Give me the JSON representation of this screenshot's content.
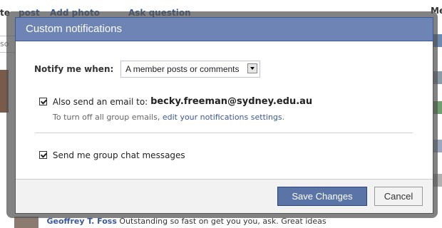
{
  "background": {
    "top_fragment_left": "te",
    "top_fragment_post": "post",
    "add_photo": "Add photo",
    "ask_question": "Ask question",
    "right_fragment": "Me",
    "left_input_fragment": "so",
    "bottom_name": "Geoffrey T. Foss",
    "bottom_text": " Outstanding so fast on get you you, ask. Great ideas"
  },
  "dialog": {
    "title": "Custom notifications",
    "notify_label": "Notify me when:",
    "notify_select_value": "A member posts or comments",
    "email_checked": true,
    "email_label": "Also send an email to:",
    "email_address": "becky.freeman@sydney.edu.au",
    "hint_prefix": "To turn off all group emails,",
    "hint_link": "edit your notifications settings",
    "hint_suffix": ".",
    "chat_checked": true,
    "chat_label": "Send me group chat messages",
    "save_label": "Save Changes",
    "cancel_label": "Cancel"
  },
  "colors": {
    "header_bg": "#6d84b4",
    "accent_link": "#3b5998",
    "save_bg": "#5b74a8"
  }
}
